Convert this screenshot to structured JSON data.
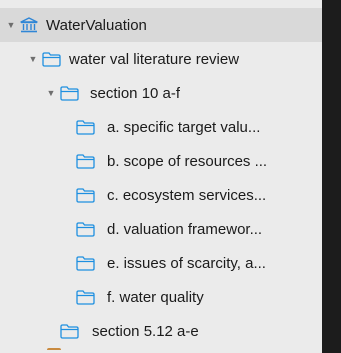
{
  "tree": {
    "library": {
      "label": "WaterValuation",
      "icon": "library-icon",
      "expanded": true
    },
    "collection": {
      "label": "water val literature review",
      "icon": "folder-icon",
      "expanded": true
    },
    "subcollection": {
      "label": "section 10 a-f",
      "icon": "folder-icon",
      "expanded": true
    },
    "items": [
      {
        "label": "a. specific target valu..."
      },
      {
        "label": "b. scope of resources ..."
      },
      {
        "label": "c. ecosystem services..."
      },
      {
        "label": "d. valuation framewor..."
      },
      {
        "label": "e. issues of scarcity, a..."
      },
      {
        "label": "f. water quality"
      }
    ],
    "sibling": {
      "label": "section 5.12 a-e",
      "icon": "folder-icon"
    }
  },
  "colors": {
    "accent": "#1e8fe0",
    "library_icon": "#2f86d6",
    "panel_background": "#ebebeb",
    "selected_row": "#d9d9d9",
    "partial_icon": "#c98a3f"
  }
}
